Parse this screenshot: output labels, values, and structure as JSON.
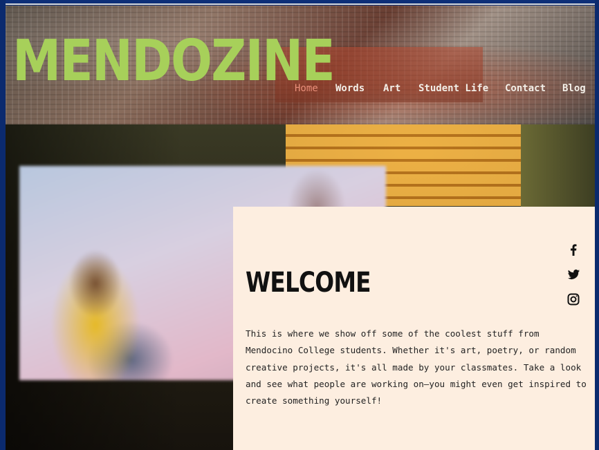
{
  "header": {
    "logo": "MENDOZINE",
    "nav": [
      {
        "label": "Home",
        "active": true
      },
      {
        "label": "Words",
        "active": false
      },
      {
        "label": "Art",
        "active": false
      },
      {
        "label": "Student Life",
        "active": false
      },
      {
        "label": "Contact",
        "active": false
      },
      {
        "label": "Blog",
        "active": false
      }
    ]
  },
  "welcome": {
    "title": "WELCOME",
    "text": "This is where we show off some of the coolest stuff from Mendocino College students. Whether it's art, poetry, or random creative projects, it's all made by your classmates. Take a look and see what people are working on—you might even get inspired to create something yourself!"
  },
  "social": [
    {
      "icon": "facebook-icon"
    },
    {
      "icon": "twitter-icon"
    },
    {
      "icon": "instagram-icon"
    }
  ],
  "colors": {
    "logo": "#a7d05a",
    "nav_active": "#e98f7a",
    "nav": "#f3efe8",
    "card_bg": "#fdeee0",
    "frame": "#0b2a6e"
  }
}
